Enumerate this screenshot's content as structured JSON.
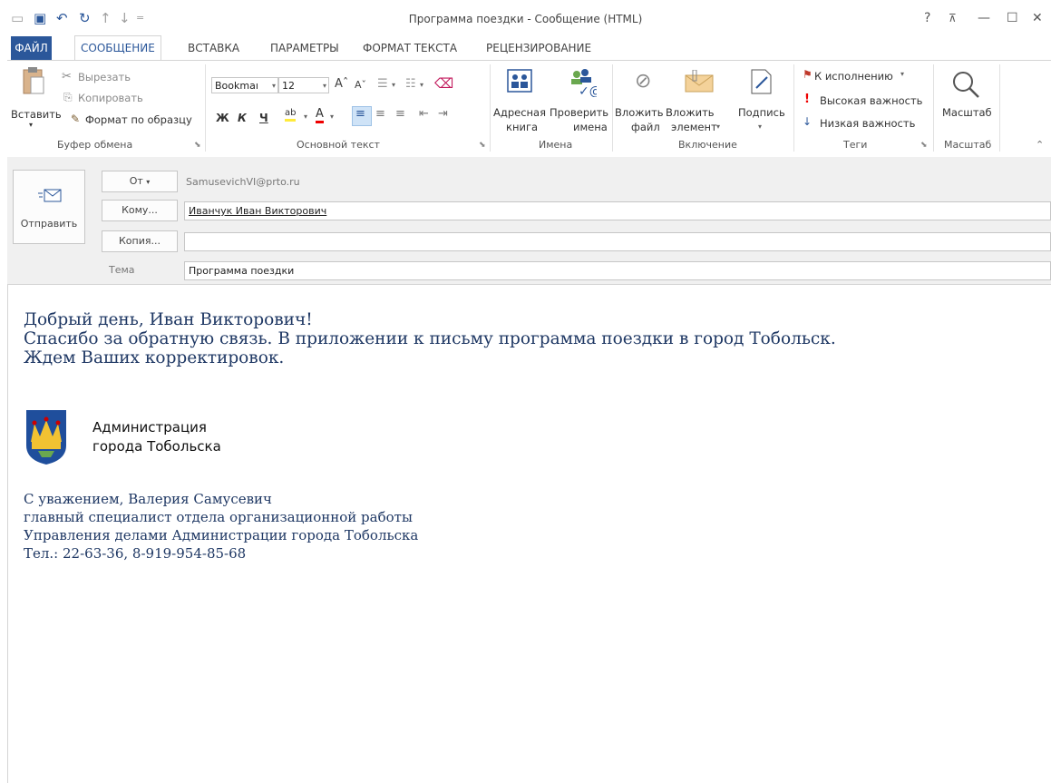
{
  "window": {
    "title": "Программа поездки - Сообщение (HTML)",
    "help_label": "?",
    "ribbon_display_label": "⊼",
    "minimize_label": "—",
    "maximize_label": "☐",
    "close_label": "✕"
  },
  "tabs": [
    {
      "label": "ФАЙЛ"
    },
    {
      "label": "СООБЩЕНИЕ"
    },
    {
      "label": "ВСТАВКА"
    },
    {
      "label": "ПАРАМЕТРЫ"
    },
    {
      "label": "ФОРМАТ ТЕКСТА"
    },
    {
      "label": "РЕЦЕНЗИРОВАНИЕ"
    }
  ],
  "ribbon": {
    "clipboard": {
      "paste": "Вставить",
      "cut": "Вырезать",
      "copy": "Копировать",
      "format_painter": "Формат по образцу",
      "group_label": "Буфер обмена"
    },
    "basic_text": {
      "font_name": "Bookmaı",
      "font_size": "12",
      "bold": "Ж",
      "italic": "К",
      "underline": "Ч",
      "group_label": "Основной текст"
    },
    "names": {
      "address_book": [
        "Адресная",
        "книга"
      ],
      "check_names": [
        "Проверить",
        "имена"
      ],
      "group_label": "Имена"
    },
    "include": {
      "attach_file": [
        "Вложить",
        "файл"
      ],
      "attach_item": [
        "Вложить",
        "элемент"
      ],
      "signature": "Подпись",
      "group_label": "Включение"
    },
    "tags": {
      "follow_up": "К исполнению",
      "high_importance": "Высокая важность",
      "low_importance": "Низкая важность",
      "group_label": "Теги"
    },
    "zoom": {
      "zoom": "Масштаб",
      "group_label": "Масштаб"
    }
  },
  "header": {
    "send_label": "Отправить",
    "from_label": "От",
    "from_value": "SamusevichVI@prto.ru",
    "to_label": "Кому...",
    "to_value": "Иванчук Иван Викторович",
    "cc_label": "Копия...",
    "cc_value": "",
    "subject_label": "Тема",
    "subject_value": "Программа поездки"
  },
  "message": {
    "lines": [
      "Добрый день, Иван Викторович!",
      "Спасибо за обратную связь. В приложении к письму программа поездки в город Тобольск.",
      "Ждем Ваших корректировок."
    ],
    "org_line1": "Администрация",
    "org_line2": "города Тобольска",
    "signature": [
      "С уважением, Валерия Самусевич",
      "главный специалист отдела организационной работы",
      "Управления делами Администрации города Тобольска",
      "Тел.: 22-63-36, 8-919-954-85-68"
    ]
  },
  "colors": {
    "accent": "#2b579a",
    "body_text": "#1f3864",
    "header_bg": "#f0f0f0"
  }
}
